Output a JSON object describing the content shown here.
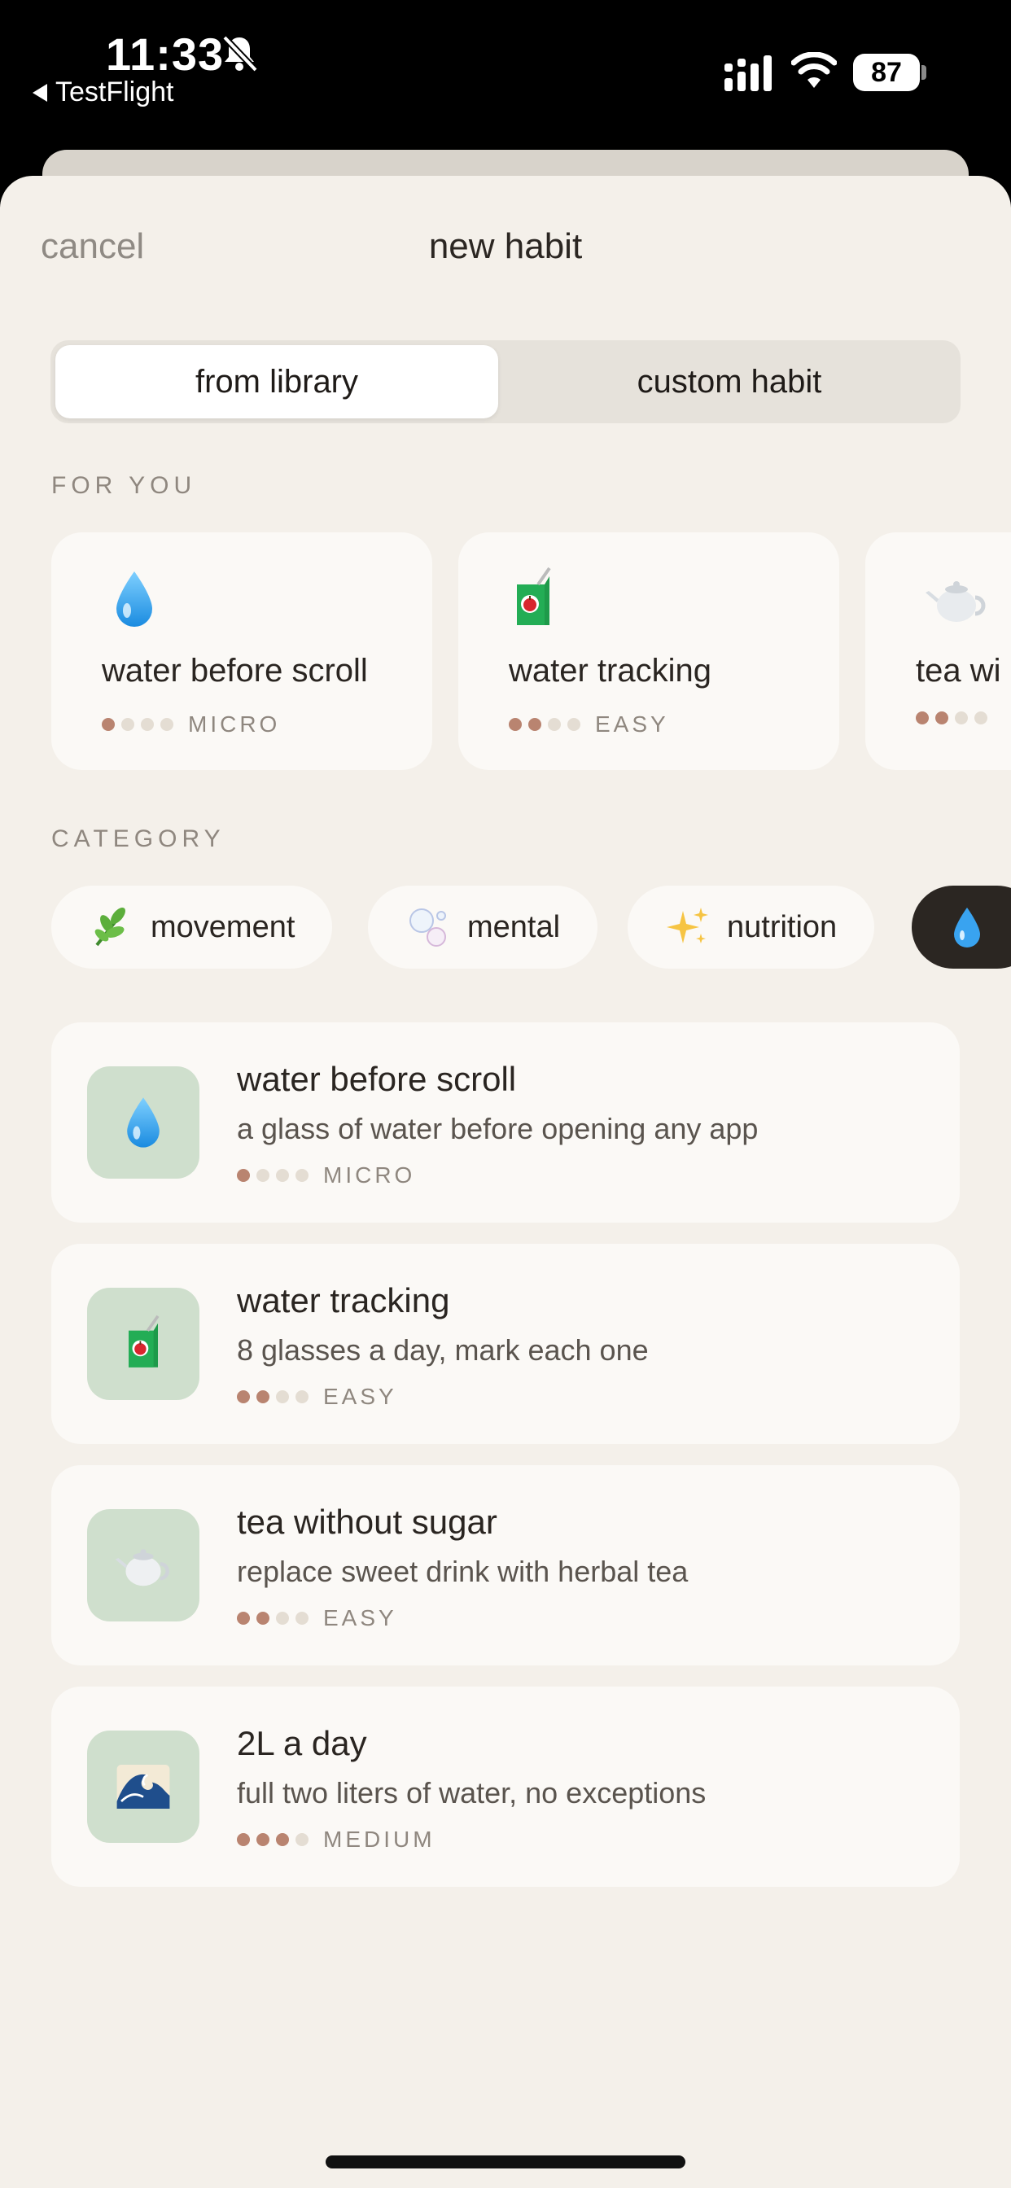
{
  "status_bar": {
    "time": "11:33",
    "back_app": "TestFlight",
    "battery": "87"
  },
  "nav": {
    "cancel": "cancel",
    "title": "new habit"
  },
  "segmented": {
    "left": "from library",
    "right": "custom habit"
  },
  "for_you": {
    "label": "FOR YOU",
    "cards": [
      {
        "icon": "droplet-icon",
        "title": "water before scroll",
        "difficulty": 1,
        "level": "MICRO"
      },
      {
        "icon": "juice-box-icon",
        "title": "water tracking",
        "difficulty": 2,
        "level": "EASY"
      },
      {
        "icon": "teapot-icon",
        "title": "tea wi",
        "difficulty": 2,
        "level": ""
      }
    ]
  },
  "category": {
    "label": "CATEGORY",
    "chips": [
      {
        "icon": "herb-icon",
        "label": "movement"
      },
      {
        "icon": "bubbles-icon",
        "label": "mental"
      },
      {
        "icon": "sparkles-icon",
        "label": "nutrition"
      },
      {
        "icon": "droplet-icon",
        "label": "",
        "active": true
      }
    ]
  },
  "habits": [
    {
      "icon": "droplet-icon",
      "title": "water before scroll",
      "desc": "a glass of water before opening any app",
      "difficulty": 1,
      "level": "MICRO"
    },
    {
      "icon": "juice-box-icon",
      "title": "water tracking",
      "desc": "8 glasses a day, mark each one",
      "difficulty": 2,
      "level": "EASY"
    },
    {
      "icon": "teapot-icon",
      "title": "tea without sugar",
      "desc": "replace sweet drink with herbal tea",
      "difficulty": 2,
      "level": "EASY"
    },
    {
      "icon": "wave-icon",
      "title": "2L a day",
      "desc": "full two liters of water, no exceptions",
      "difficulty": 3,
      "level": "MEDIUM"
    }
  ],
  "colors": {
    "sheet_bg": "#f4f0ea",
    "card_bg": "#fbf9f6",
    "tile_bg": "#cfdfcd",
    "dot_on": "#b98470",
    "dot_off": "#e4ddd3",
    "active_chip": "#2b2622"
  }
}
